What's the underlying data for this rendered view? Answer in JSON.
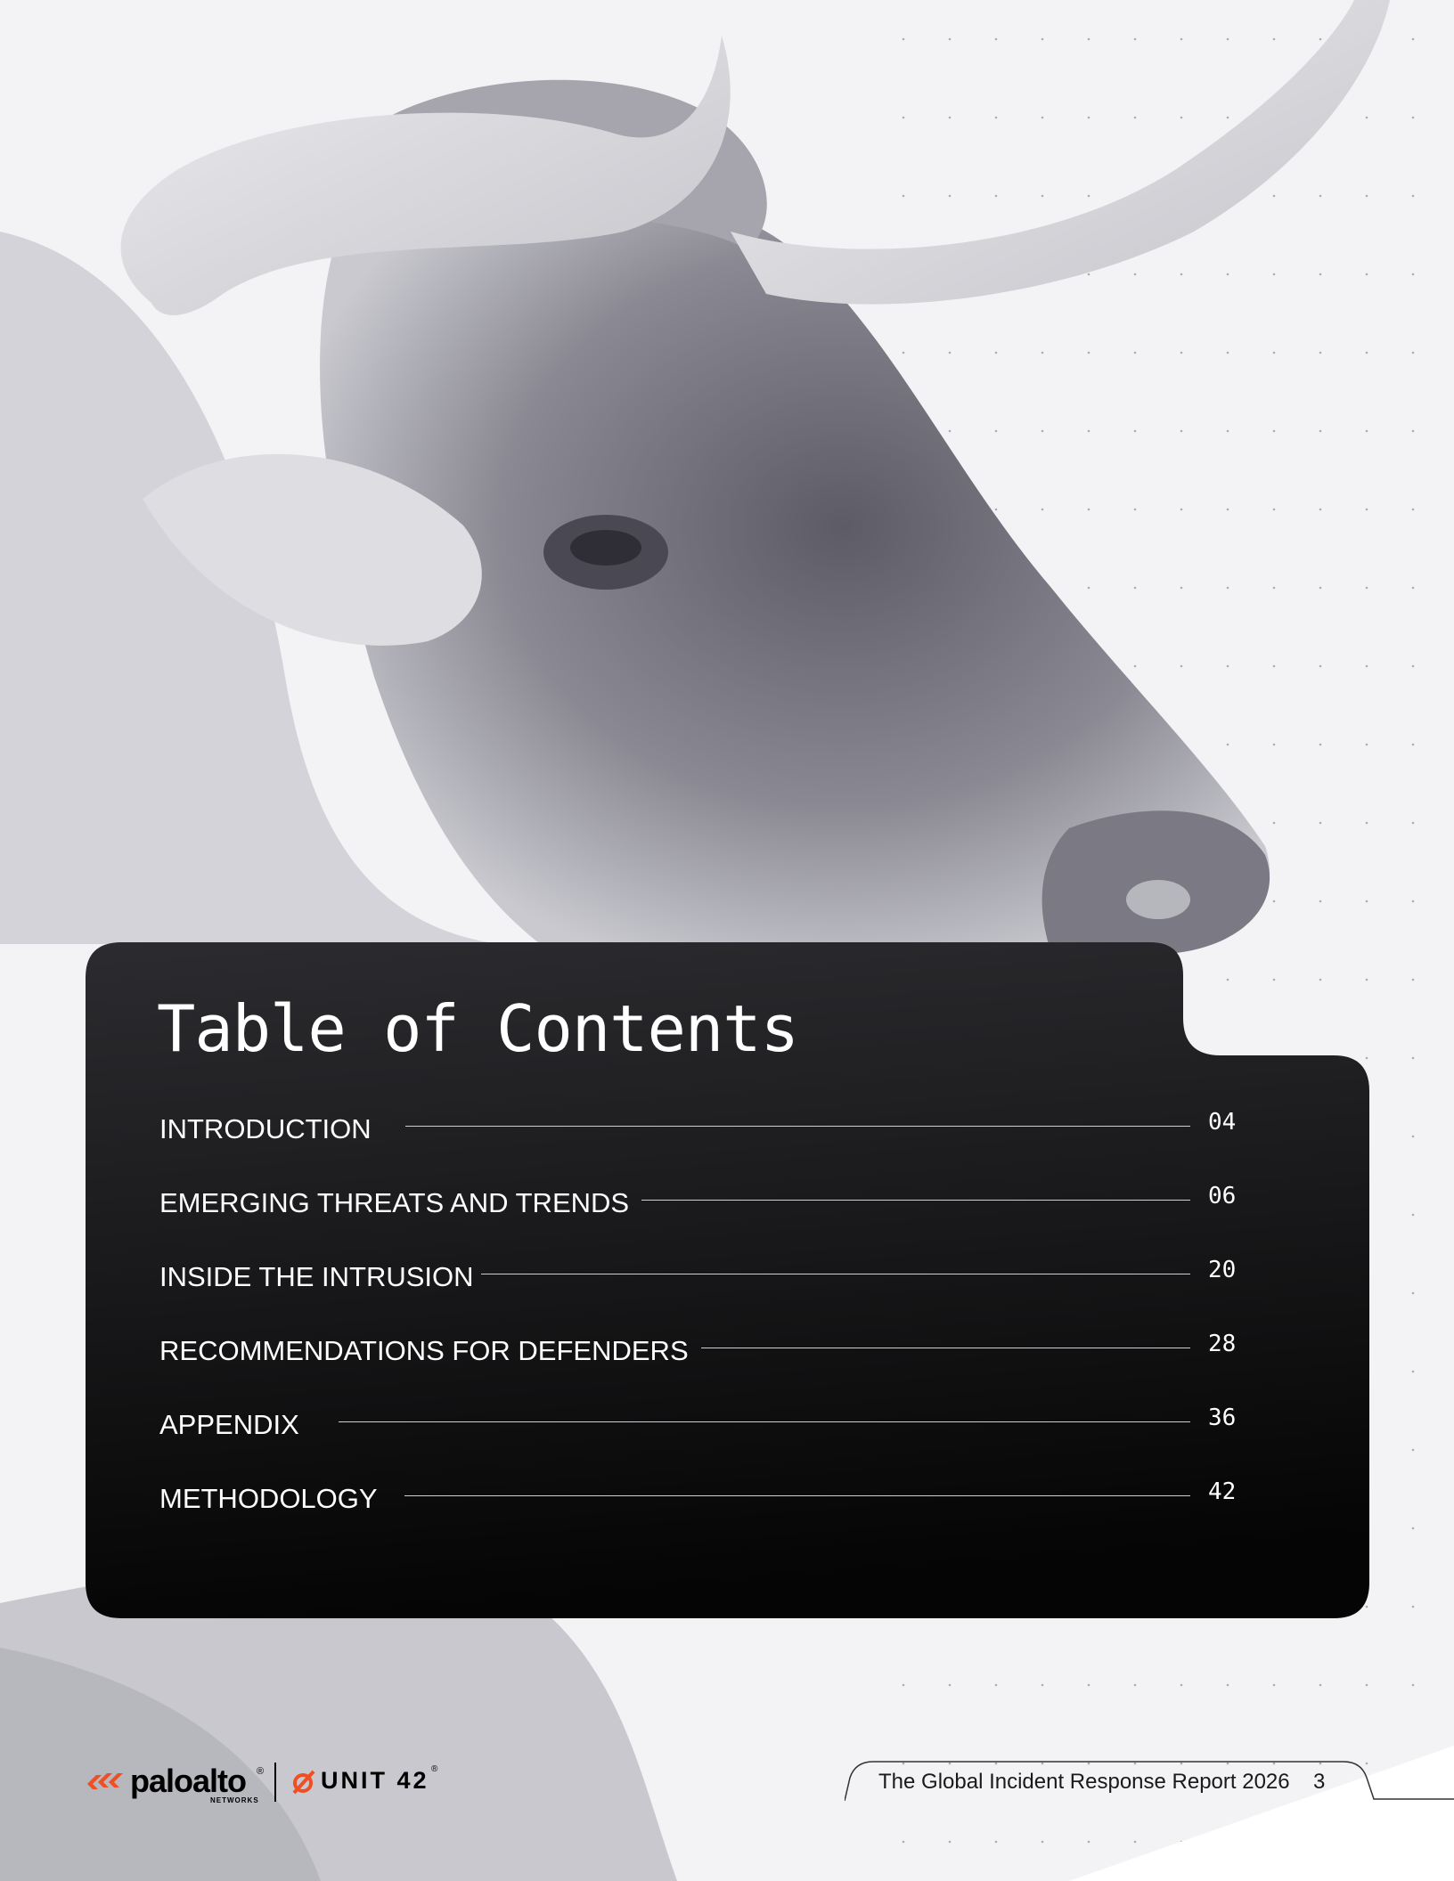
{
  "toc": {
    "title": "Table of Contents",
    "items": [
      {
        "label": "INTRODUCTION",
        "page": "04"
      },
      {
        "label": "EMERGING THREATS AND TRENDS",
        "page": "06"
      },
      {
        "label": "INSIDE THE INTRUSION",
        "page": "20"
      },
      {
        "label": "RECOMMENDATIONS FOR DEFENDERS",
        "page": "28"
      },
      {
        "label": "APPENDIX",
        "page": "36"
      },
      {
        "label": "METHODOLOGY",
        "page": "42"
      }
    ]
  },
  "footer": {
    "brand_name": "paloalto",
    "brand_sub": "NETWORKS",
    "unit_name": "UNIT 42",
    "report_title": "The Global Incident Response Report 2026",
    "page_number": "3"
  },
  "colors": {
    "card": "#0b0b0c",
    "background": "#f1f1f3",
    "brand_orange": "#f04e23"
  },
  "icons": [
    "bull-photo",
    "paloalto-logo-icon",
    "unit42-logo-icon"
  ]
}
